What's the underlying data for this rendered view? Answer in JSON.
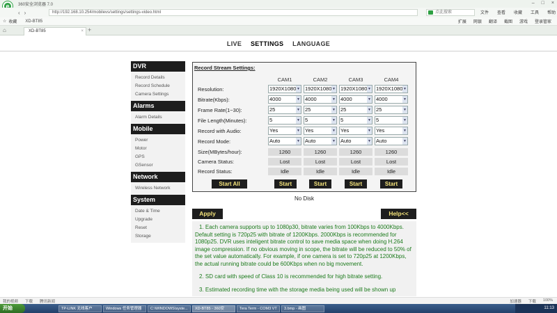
{
  "browser": {
    "title": "360安全浏览器 7.0",
    "window_controls": [
      "–",
      "□",
      "×"
    ],
    "url": "http://192.168.10.254/mobilevs/settings/settings-video.html",
    "search_placeholder": "点此搜索",
    "menu": [
      "文件",
      "查看",
      "收藏",
      "工具",
      "帮助"
    ],
    "favorites": [
      "收藏",
      "XD-BT85"
    ],
    "tools": [
      "扩展",
      "网银",
      "翻译",
      "截图",
      "游戏",
      "登录管家"
    ],
    "tab_label": "XD-BT85"
  },
  "nav": {
    "items": [
      "LIVE",
      "SETTINGS",
      "LANGUAGE"
    ]
  },
  "sidebar": {
    "sections": [
      {
        "title": "DVR",
        "items": [
          "Record Details",
          "Record Schedule",
          "Camera Settings"
        ]
      },
      {
        "title": "Alarms",
        "items": [
          "Alarm Details"
        ]
      },
      {
        "title": "Mobile",
        "items": [
          "Power",
          "Motor",
          "GPS",
          "GSensor"
        ]
      },
      {
        "title": "Network",
        "items": [
          "Wireless Network"
        ]
      },
      {
        "title": "System",
        "items": [
          "Date & Time",
          "Upgrade",
          "Reset",
          "Storage"
        ]
      }
    ]
  },
  "record": {
    "title": "Record Stream Settings:",
    "cams": [
      "CAM1",
      "CAM2",
      "CAM3",
      "CAM4"
    ],
    "rows": [
      {
        "label": "Resolution:",
        "values": [
          "1920X1080",
          "1920X1080",
          "1920X1080",
          "1920X1080"
        ]
      },
      {
        "label": "Bitrate(Kbps):",
        "values": [
          "4000",
          "4000",
          "4000",
          "4000"
        ]
      },
      {
        "label": "Frame Rate(1~30):",
        "values": [
          "25",
          "25",
          "25",
          "25"
        ]
      },
      {
        "label": "File Length(Minutes):",
        "values": [
          "5",
          "5",
          "5",
          "5"
        ]
      },
      {
        "label": "Record with Audio:",
        "values": [
          "Yes",
          "Yes",
          "Yes",
          "Yes"
        ]
      },
      {
        "label": "Record Mode:",
        "values": [
          "Auto",
          "Auto",
          "Auto",
          "Auto"
        ]
      }
    ],
    "status_rows": [
      {
        "label": "Size(MBytes/hour):",
        "values": [
          "1260",
          "1260",
          "1260",
          "1260"
        ]
      },
      {
        "label": "Camera Status:",
        "values": [
          "Lost",
          "Lost",
          "Lost",
          "Lost"
        ]
      },
      {
        "label": "Record Status:",
        "values": [
          "Idle",
          "Idle",
          "Idle",
          "Idle"
        ]
      }
    ],
    "start_all": "Start All",
    "start": "Start"
  },
  "no_disk": "No Disk",
  "apply": "Apply",
  "help_button": "Help<<",
  "help": [
    "1.  Each camera supports up to 1080p30, bitrate varies from 100Kbps to 4000Kbps. Default setting is 720p25 with bitrate of 1200Kbps. 2000Kbps is recommended for 1080p25. DVR uses inteligent bitrate control to save media space when doing H.264 image compression. If no obvious moving in scope, the bitrate will be reduced to 50% of the set value automatically. For example, if one camera is set to 720p25 at 1200Kbps, the actual running bitrate could be 600Kbps when no big movement.",
    "2.  SD card with speed of Class 10 is recommended for high bitrate setting.",
    "3.  Estimated recording time with the storage media being used will be shown up"
  ],
  "statusbar": {
    "left": [
      "我的视频",
      "下载",
      "腾讯新闻"
    ],
    "right": [
      "加速器",
      "下载",
      "100%"
    ]
  },
  "taskbar": {
    "start": "开始",
    "tasks": [
      "TP-LINK 无线客户",
      "Windows 任务管理器",
      "C:\\WINDOWS\\syste...",
      "XD-BT85 - 360安",
      "Tera Term - COM3 VT",
      "3.bmp - 画图"
    ],
    "clock": "11:13"
  }
}
